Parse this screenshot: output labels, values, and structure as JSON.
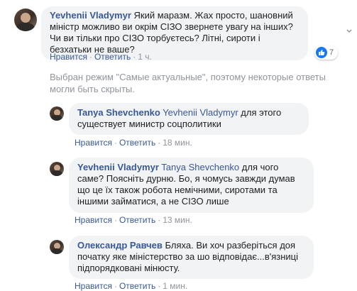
{
  "root_comment": {
    "author": "Yevhenii Vladymyr",
    "text": "Який маразм. Жах просто, шановний міністр можливо ви окрім СІЗО звернете увагу на інших? Чи ви тільки про СІЗО торбуєтесь? Літні, сироти і безхатьки не ваше?",
    "actions": {
      "like": "Нравится",
      "reply": "Ответить",
      "time": "1 ч."
    },
    "reactions": {
      "icon": "like-icon",
      "count": "7",
      "color": "#1877f2"
    }
  },
  "notice": "Выбран режим \"Самые актуальные\", поэтому некоторые ответы могли быть скрыты.",
  "replies": [
    {
      "author": "Tanya Shevchenko",
      "tag": "Yevhenii Vladymyr",
      "text": "для этого существует министр соцполитики",
      "actions": {
        "like": "Нравится",
        "reply": "Ответить",
        "time": "18 мин."
      }
    },
    {
      "author": "Yevhenii Vladymyr",
      "tag": "Tanya Shevchenko",
      "text": "для чого саме? Поясніть дурню. Бо, я чомусь завжди думав що це їх також робота немічними, сиротами та іншими займатися, а не СІЗО лише",
      "actions": {
        "like": "Нравится",
        "reply": "Ответить",
        "time": "13 мин."
      }
    },
    {
      "author": "Олександр Равчев",
      "text": "Бляха. Ви хоч разберіться доя початку яке міністерство за шо відповідає...в'язниці підпорядковані мінюсту.",
      "actions": {
        "like": "Нравится",
        "reply": "Ответить",
        "time": "1 мин."
      }
    }
  ]
}
